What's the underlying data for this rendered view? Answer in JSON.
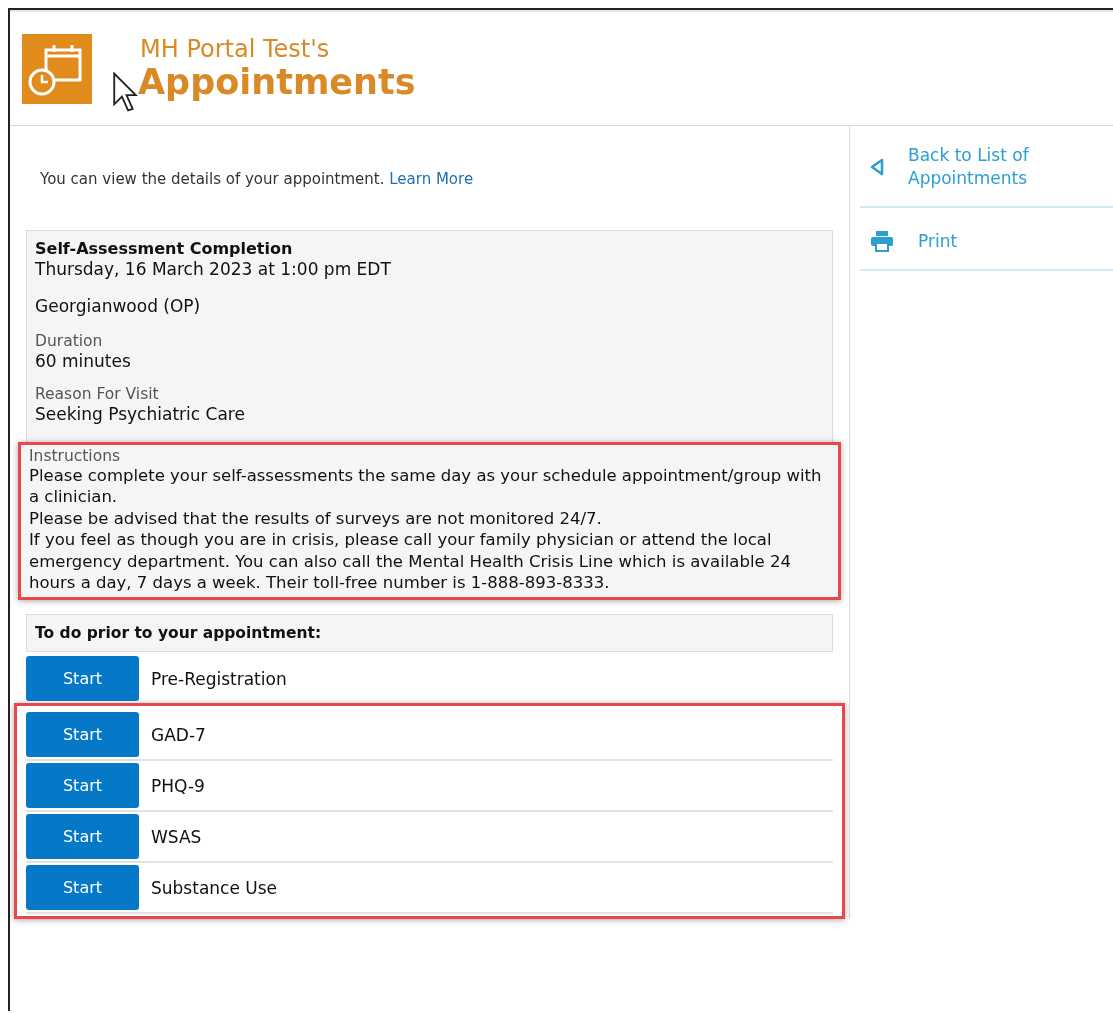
{
  "header": {
    "owner": "MH Portal Test's",
    "title": "Appointments"
  },
  "intro": {
    "text": "You can view the details of your appointment.",
    "link": "Learn More"
  },
  "appointment": {
    "title": "Self-Assessment Completion",
    "datetime": "Thursday, 16 March 2023 at 1:00 pm EDT",
    "location": "Georgianwood (OP)",
    "fields": [
      {
        "label": "Duration",
        "value": "60 minutes"
      },
      {
        "label": "Reason For Visit",
        "value": "Seeking Psychiatric Care"
      }
    ],
    "instructions": {
      "label": "Instructions",
      "highlighted": true,
      "paragraphs": [
        "Please complete your self-assessments the same day as your schedule appointment/group with a clinician.",
        "Please be advised that the results of surveys are not monitored 24/7.",
        "If you feel as though you are in crisis, please call your family physician or attend the local emergency department. You can also call the Mental Health Crisis Line which is available 24 hours a day, 7 days a week. Their toll-free number is 1-888-893-8333."
      ]
    }
  },
  "todo": {
    "heading": "To do prior to your appointment:",
    "tasks": [
      {
        "button": "Start",
        "name": "Pre-Registration",
        "highlighted": false
      },
      {
        "button": "Start",
        "name": "GAD-7",
        "highlighted": true
      },
      {
        "button": "Start",
        "name": "PHQ-9",
        "highlighted": true
      },
      {
        "button": "Start",
        "name": "WSAS",
        "highlighted": true
      },
      {
        "button": "Start",
        "name": "Substance Use",
        "highlighted": true
      }
    ]
  },
  "sidebar": {
    "items": [
      {
        "kind": "back",
        "label": "Back to List of Appointments"
      },
      {
        "kind": "print",
        "label": "Print"
      }
    ]
  }
}
